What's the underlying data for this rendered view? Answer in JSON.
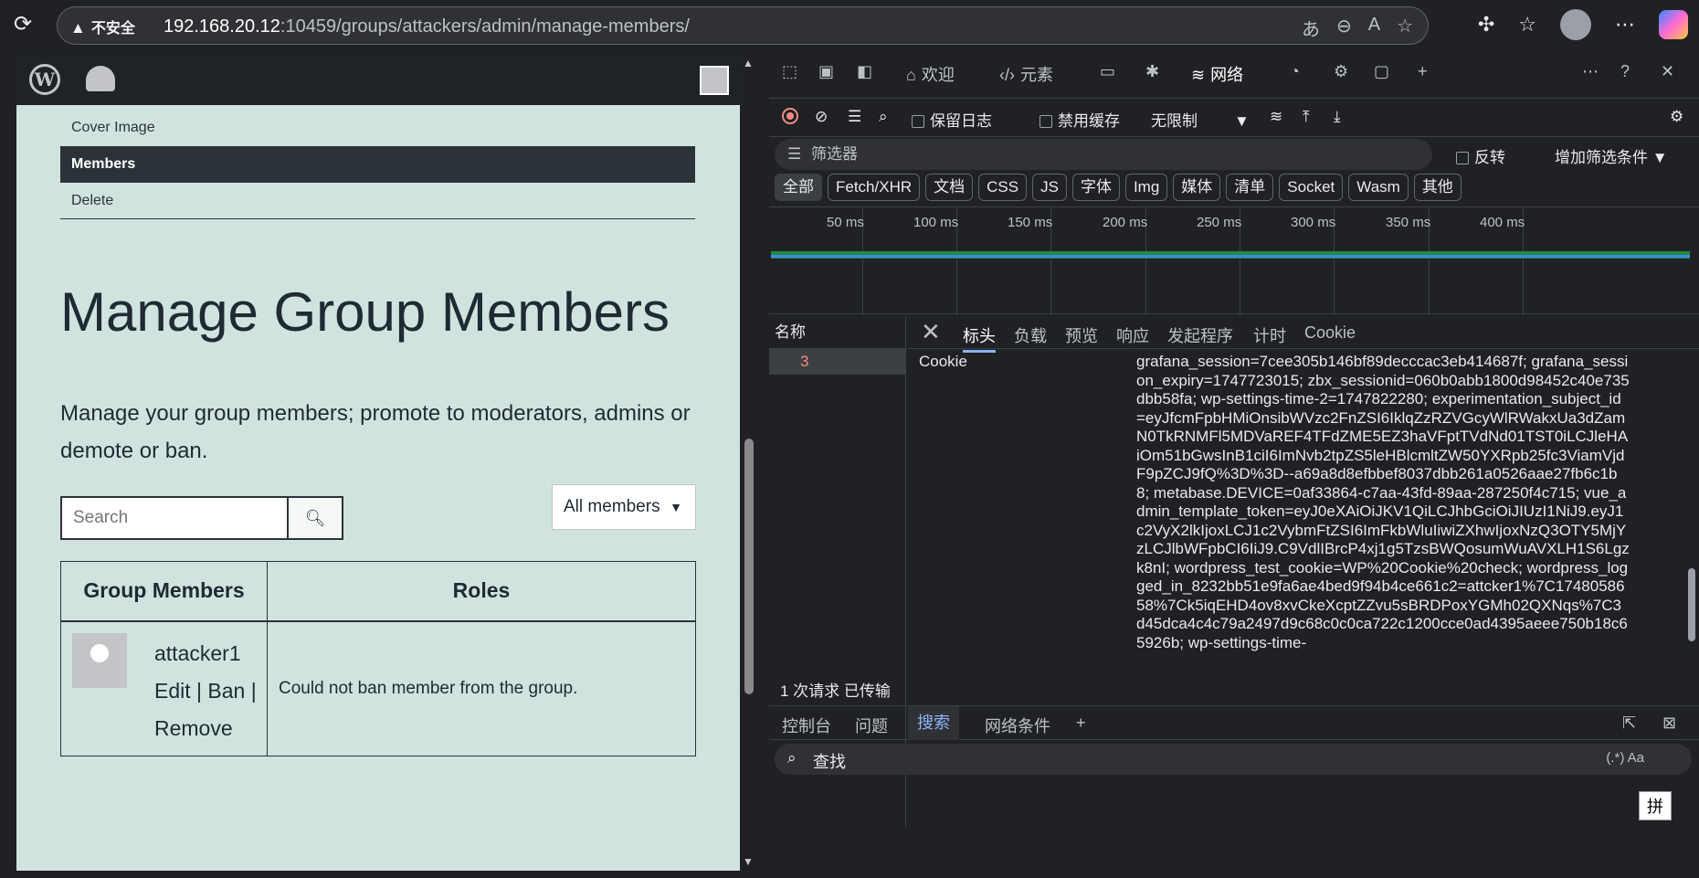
{
  "browser": {
    "security_label": "不安全",
    "url_host": "192.168.20.12",
    "url_rest": ":10459/groups/attackers/admin/manage-members/"
  },
  "page": {
    "subnav": [
      "Cover Image",
      "Members",
      "Delete"
    ],
    "title": "Manage Group Members",
    "description": "Manage your group members; promote to moderators, admins or demote or ban.",
    "search_placeholder": "Search",
    "filter_value": "All members",
    "table": {
      "headers": [
        "Group Members",
        "Roles"
      ],
      "rows": [
        {
          "name": "attacker1",
          "actions": "Edit | Ban |",
          "remove": "Remove",
          "role": "Could not ban member from the group."
        }
      ]
    }
  },
  "devtools": {
    "tabs": [
      "欢迎",
      "元素",
      "网络"
    ],
    "toolbar": {
      "preserve_log": "保留日志",
      "disable_cache": "禁用缓存",
      "throttle": "无限制"
    },
    "filter": {
      "placeholder": "筛选器",
      "invert": "反转",
      "more": "增加筛选条件"
    },
    "types": [
      "全部",
      "Fetch/XHR",
      "文档",
      "CSS",
      "JS",
      "字体",
      "Img",
      "媒体",
      "清单",
      "Socket",
      "Wasm",
      "其他"
    ],
    "timeline_ticks": [
      "50 ms",
      "100 ms",
      "150 ms",
      "200 ms",
      "250 ms",
      "300 ms",
      "350 ms",
      "400 ms"
    ],
    "name_header": "名称",
    "request_name": "3",
    "footer": "1 次请求  已传输",
    "detail_tabs": [
      "标头",
      "负载",
      "预览",
      "响应",
      "发起程序",
      "计时",
      "Cookie"
    ],
    "header_name": "Cookie",
    "header_value": "grafana_session=7cee305b146bf89decccac3eb414687f; grafana_session_expiry=1747723015; zbx_sessionid=060b0abb1800d98452c40e735dbb58fa; wp-settings-time-2=1747822280; experimentation_subject_id=eyJfcmFpbHMiOnsibWVzc2FnZSI6IklqZzRZVGcyWlRWakxUa3dZamN0TkRNMFl5MDVaREF4TFdZME5EZ3haVFptTVdNd01TST0iLCJleHAiOm51bGwsInB1ciI6ImNvb2tpZS5leHBlcmltZW50YXRpb25fc3ViamVjdF9pZCJ9fQ%3D%3D--a69a8d8efbbef8037dbb261a0526aae27fb6c1b8; metabase.DEVICE=0af33864-c7aa-43fd-89aa-287250f4c715; vue_admin_template_token=eyJ0eXAiOiJKV1QiLCJhbGciOiJIUzI1NiJ9.eyJ1c2VyX2lkIjoxLCJ1c2VybmFtZSI6ImFkbWluIiwiZXhwIjoxNzQ3OTY5MjYzLCJlbWFpbCI6IiJ9.C9VdlIBrcP4xj1g5TzsBWQosumWuAVXLH1S6Lgzk8nI; wordpress_test_cookie=WP%20Cookie%20check; wordpress_logged_in_8232bb51e9fa6ae4bed9f94b4ce661c2=attcker1%7C1748058658%7Ck5iqEHD4ov8xvCkeXcptZZvu5sBRDPoxYGMh02QXNqs%7C3d45dca4c4c79a2497d9c68c0c0ca722c1200cce0ad4395aeee750b18c65926b; wp-settings-time-",
    "drawer_tabs": [
      "控制台",
      "问题",
      "搜索",
      "网络条件"
    ],
    "search_placeholder": "查找",
    "search_opts": "(.*)  Aa",
    "ime": "拼"
  }
}
